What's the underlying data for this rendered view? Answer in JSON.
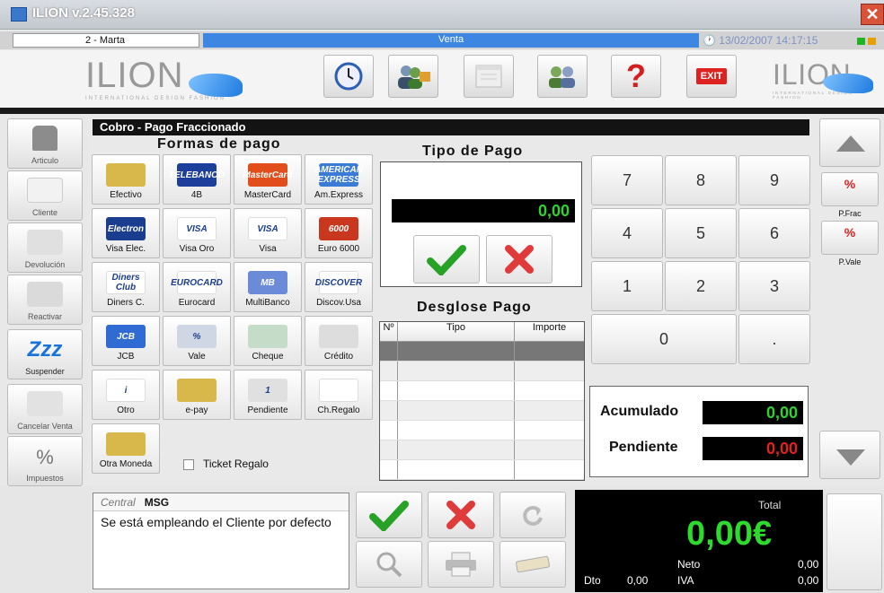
{
  "window": {
    "title": "ILION v.2.45.328",
    "close": "✕"
  },
  "status": {
    "user": "2 - Marta",
    "mode": "Venta",
    "datetime": "13/02/2007 14:17:15",
    "colors": {
      "mode_bg": "#3d86e1",
      "ok": "#1fb31f",
      "warn": "#e8a000"
    }
  },
  "header": {
    "logo": "ILION",
    "logo_sub": "INTERNATIONAL DESIGN FASHION",
    "toolbar": [
      {
        "name": "clock-icon"
      },
      {
        "name": "users-lock-icon"
      },
      {
        "name": "window-icon"
      },
      {
        "name": "group-icon"
      },
      {
        "name": "help-icon",
        "label": "?"
      },
      {
        "name": "exit-icon",
        "label": "EXIT"
      }
    ]
  },
  "left": {
    "items": [
      {
        "label": "Articulo",
        "icon": "shirt-icon"
      },
      {
        "label": "Cliente",
        "icon": "card-icon"
      },
      {
        "label": "Devolución",
        "icon": "return-icon"
      },
      {
        "label": "Reactivar",
        "icon": "reactivate-icon"
      },
      {
        "label": "Suspender",
        "icon": "sleep-icon",
        "glyph": "Zzz"
      },
      {
        "label": "Cancelar Venta",
        "icon": "cancel-sale-icon"
      },
      {
        "label": "Impuestos",
        "icon": "tax-icon",
        "glyph": "%"
      }
    ]
  },
  "panel": {
    "title": "Cobro - Pago Fraccionado",
    "formas_title": "Formas de pago",
    "ticket_regalo": "Ticket Regalo"
  },
  "payments": [
    {
      "label": "Efectivo",
      "badge": "",
      "color": "#d8b84a"
    },
    {
      "label": "4B",
      "badge": "TELEBANCO",
      "color": "#1d3f9b"
    },
    {
      "label": "MasterCard",
      "badge": "MasterCard",
      "color": "#e24e1b"
    },
    {
      "label": "Am.Express",
      "badge": "AMERICAN EXPRESS",
      "color": "#3a7bd5"
    },
    {
      "label": "Visa Elec.",
      "badge": "Electron",
      "color": "#1a3d8f"
    },
    {
      "label": "Visa Oro",
      "badge": "VISA",
      "color": "#ffffff"
    },
    {
      "label": "Visa",
      "badge": "VISA",
      "color": "#ffffff"
    },
    {
      "label": "Euro 6000",
      "badge": "6000",
      "color": "#c8371e"
    },
    {
      "label": "Diners C.",
      "badge": "Diners Club",
      "color": "#ffffff"
    },
    {
      "label": "Eurocard",
      "badge": "EUROCARD",
      "color": "#ffffff"
    },
    {
      "label": "MultiBanco",
      "badge": "MB",
      "color": "#6b8bd8"
    },
    {
      "label": "Discov.Usa",
      "badge": "DISCOVER",
      "color": "#ffffff"
    },
    {
      "label": "JCB",
      "badge": "JCB",
      "color": "#2f6bd3"
    },
    {
      "label": "Vale",
      "badge": "%",
      "color": "#cfd7e4"
    },
    {
      "label": "Cheque",
      "badge": "",
      "color": "#c4dcc8"
    },
    {
      "label": "Crédito",
      "badge": "",
      "color": "#dddddd"
    },
    {
      "label": "Otro",
      "badge": "i",
      "color": "#ffffff"
    },
    {
      "label": "e-pay",
      "badge": "",
      "color": "#d8b84a"
    },
    {
      "label": "Pendiente",
      "badge": "1",
      "color": "#e0e0e0"
    },
    {
      "label": "Ch.Regalo",
      "badge": "",
      "color": "#ffffff"
    },
    {
      "label": "Otra Moneda",
      "badge": "",
      "color": "#d8b84a"
    }
  ],
  "tipo": {
    "title": "Tipo de Pago",
    "amount": "0,00"
  },
  "desglose": {
    "title": "Desglose Pago",
    "columns": [
      "Nº",
      "Tipo",
      "Importe"
    ],
    "rows": 7
  },
  "keypad": {
    "keys": [
      "7",
      "8",
      "9",
      "4",
      "5",
      "6",
      "1",
      "2",
      "3",
      "0",
      "."
    ]
  },
  "totals": {
    "acumulado_label": "Acumulado",
    "acumulado": "0,00",
    "pendiente_label": "Pendiente",
    "pendiente": "0,00"
  },
  "right": {
    "pfrac": "P.Frac",
    "pvale": "P.Vale",
    "badge": "%"
  },
  "message": {
    "source": "Central",
    "type": "MSG",
    "text": "Se está empleando el Cliente por defecto"
  },
  "total": {
    "label": "Total",
    "value": "0,00€",
    "neto_label": "Neto",
    "neto": "0,00",
    "dto_label": "Dto",
    "dto": "0,00",
    "iva_label": "IVA",
    "iva": "0,00"
  }
}
